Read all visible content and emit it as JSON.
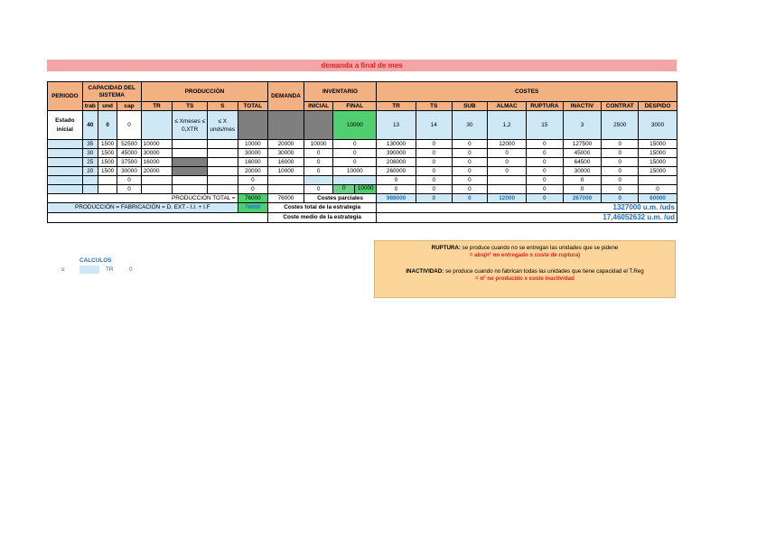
{
  "title": "demanda a final de mes",
  "headers": {
    "periodo": "PERIODO",
    "capacidad": "CAPACIDAD DEL SISTEMA",
    "produccion": "PRODUCCIÓN",
    "demanda": "DEMANDA",
    "inventario": "INVENTARIO",
    "costes": "COSTES",
    "trab": "trab",
    "und": "und",
    "cap": "cap",
    "tr": "TR",
    "ts": "TS",
    "s": "S",
    "total": "TOTAL",
    "inicial": "INICIAL",
    "final": "FINAL",
    "c_tr": "TR",
    "c_ts": "TS",
    "c_sub": "SUB",
    "c_almac": "ALMAC",
    "c_ruptura": "RUPTURA",
    "c_inactiv": "INACTIV",
    "c_contrat": "CONTRAT",
    "c_despido": "DESPIDO"
  },
  "estado": {
    "label": "Estado inicial",
    "trab": "40",
    "und": "0",
    "cap": "0",
    "ts_text": "≤ Xmeses ≤ 0,XTR",
    "s_text": "≤ X unds/mes",
    "final": "10000",
    "c_tr": "13",
    "c_ts": "14",
    "c_sub": "30",
    "c_almac": "1,2",
    "c_ruptura": "15",
    "c_inactiv": "3",
    "c_contrat": "2500",
    "c_despido": "3000"
  },
  "rows": [
    {
      "trab": "35",
      "und": "1500",
      "cap": "52500",
      "tr": "10000",
      "total": "10000",
      "dem": "20000",
      "ini": "10000",
      "fin": "0",
      "c_tr": "130000",
      "c_ts": "0",
      "c_sub": "0",
      "c_almac": "12000",
      "c_rup": "0",
      "c_ina": "127500",
      "c_con": "0",
      "c_des": "15000"
    },
    {
      "trab": "30",
      "und": "1500",
      "cap": "45000",
      "tr": "30000",
      "total": "30000",
      "dem": "30000",
      "ini": "0",
      "fin": "0",
      "c_tr": "390000",
      "c_ts": "0",
      "c_sub": "0",
      "c_almac": "0",
      "c_rup": "0",
      "c_ina": "45000",
      "c_con": "0",
      "c_des": "15000"
    },
    {
      "trab": "25",
      "und": "1500",
      "cap": "37500",
      "tr": "16000",
      "total": "16000",
      "dem": "16000",
      "ini": "0",
      "fin": "0",
      "c_tr": "208000",
      "c_ts": "0",
      "c_sub": "0",
      "c_almac": "0",
      "c_rup": "0",
      "c_ina": "64500",
      "c_con": "0",
      "c_des": "15000"
    },
    {
      "trab": "20",
      "und": "1500",
      "cap": "30000",
      "tr": "20000",
      "total": "20000",
      "dem": "10000",
      "ini": "0",
      "fin": "10000",
      "c_tr": "260000",
      "c_ts": "0",
      "c_sub": "0",
      "c_almac": "0",
      "c_rup": "0",
      "c_ina": "30000",
      "c_con": "0",
      "c_des": "15000"
    }
  ],
  "row5": {
    "cap": "0",
    "total": "0",
    "c_tr": "0",
    "c_ts": "0",
    "c_sub": "0",
    "c_rup": "0",
    "c_ina": "0",
    "c_con": "0"
  },
  "row6": {
    "cap": "0",
    "total": "0",
    "ini": "0",
    "fin_a": "0",
    "fin_b": "10000",
    "c_tr": "0",
    "c_ts": "0",
    "c_sub": "0",
    "c_rup": "0",
    "c_ina": "0",
    "c_con": "0",
    "c_des": "0"
  },
  "totals": {
    "prod_label": "PRODUCCIÓN TOTAL =",
    "prod_value": "76000",
    "demanda": "76000",
    "parciales_label": "Costes parciales",
    "c_tr": "988000",
    "c_ts": "0",
    "c_sub": "0",
    "c_almac": "12000",
    "c_rup": "0",
    "c_ina": "267000",
    "c_con": "0",
    "c_des": "60000",
    "formula_label": "PRODUCCIÓN = FABRICACIÓN = D. EXT - I.I. + I.F",
    "formula_value": "76000",
    "total_label": "Costes total de la estrategia",
    "total_value": "1327000 u.m. /uds",
    "medio_label": "Coste medio de la estrategia",
    "medio_value": "17,46052632 u.m. /ud"
  },
  "calculos": {
    "title": "CALCULOS",
    "le": "≤",
    "tr": "TR",
    "zero": "0"
  },
  "note": {
    "ruptura_label": "RUPTURA:",
    "ruptura_text": " se produce cuando no se entregan las unidades que se pidene",
    "ruptura_formula": "= abs(nº no entregado x coste de ruptura)",
    "inact_label": "INACTIVIDAD:",
    "inact_text": " se produce cuando no fabrican todas las unidades que tiene capacidad el T.Reg",
    "inact_formula": "= nº no producido x coste inactividad"
  }
}
